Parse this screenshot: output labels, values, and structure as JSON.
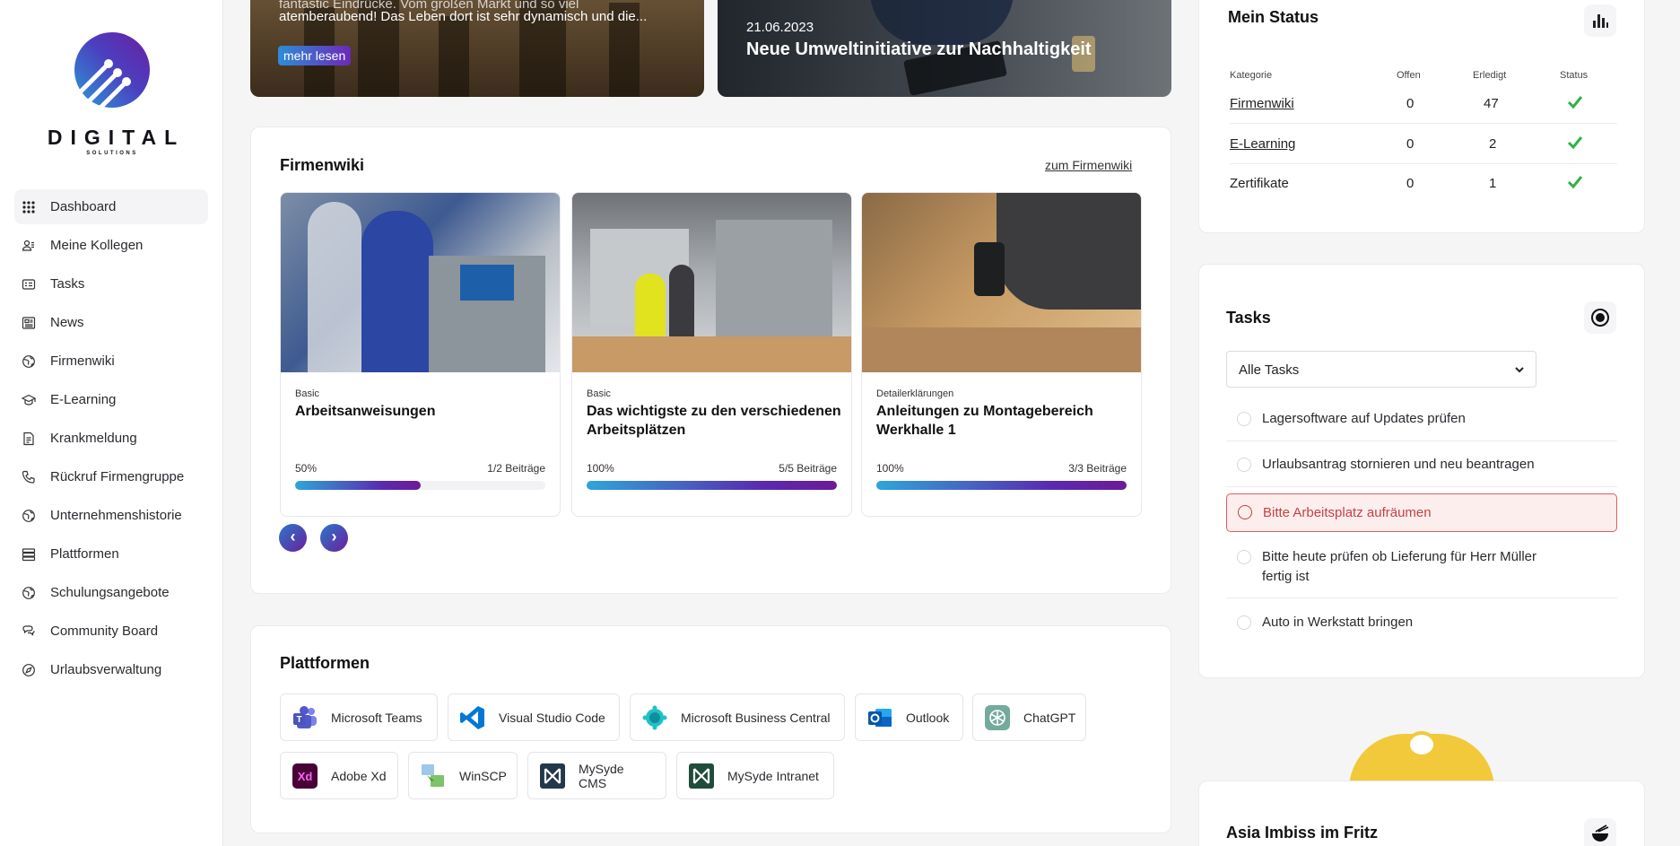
{
  "brand": {
    "name": "DIGITAL",
    "sub": "SOLUTIONS"
  },
  "nav": [
    {
      "label": "Dashboard",
      "icon": "grid-icon",
      "active": true
    },
    {
      "label": "Meine Kollegen",
      "icon": "people-icon"
    },
    {
      "label": "Tasks",
      "icon": "task-list-icon"
    },
    {
      "label": "News",
      "icon": "newspaper-icon"
    },
    {
      "label": "Firmenwiki",
      "icon": "globe-icon"
    },
    {
      "label": "E-Learning",
      "icon": "graduation-cap-icon"
    },
    {
      "label": "Krankmeldung",
      "icon": "document-icon"
    },
    {
      "label": "Rückruf Firmengruppe",
      "icon": "phone-icon"
    },
    {
      "label": "Unternehmenshistorie",
      "icon": "globe-icon"
    },
    {
      "label": "Plattformen",
      "icon": "server-icon"
    },
    {
      "label": "Schulungsangebote",
      "icon": "globe-icon"
    },
    {
      "label": "Community Board",
      "icon": "chat-icon"
    },
    {
      "label": "Urlaubsverwaltung",
      "icon": "compass-icon"
    }
  ],
  "news": [
    {
      "text_line1": "fantastic Eindrücke. Vom großen Markt und so viel",
      "text": "atemberaubend! Das Leben dort ist sehr dynamisch und die...",
      "button": "mehr lesen"
    },
    {
      "date": "21.06.2023",
      "title": "Neue Umweltinitiative zur Nachhaltigkeit"
    }
  ],
  "wiki": {
    "title": "Firmenwiki",
    "link": "zum Firmenwiki",
    "cards": [
      {
        "category": "Basic",
        "title": "Arbeitsanweisungen",
        "percent": "50%",
        "progress": 0.5,
        "count": "1/2 Beiträge"
      },
      {
        "category": "Basic",
        "title": "Das wichtigste zu den verschiedenen Arbeitsplätzen",
        "percent": "100%",
        "progress": 1,
        "count": "5/5 Beiträge"
      },
      {
        "category": "Detailerklärungen",
        "title": "Anleitungen zu Montagebereich Werkhalle 1",
        "percent": "100%",
        "progress": 1,
        "count": "3/3 Beiträge"
      }
    ],
    "prev": "‹",
    "next": "›"
  },
  "platforms": {
    "title": "Plattformen",
    "items": [
      {
        "label": "Microsoft Teams",
        "icon": "microsoft-teams-icon",
        "color": "#5059c9"
      },
      {
        "label": "Visual Studio Code",
        "icon": "vscode-icon",
        "color": "#0078d4"
      },
      {
        "label": "Microsoft Business Central",
        "icon": "business-central-icon",
        "color": "#14b8c4"
      },
      {
        "label": "Outlook",
        "icon": "outlook-icon",
        "color": "#0a64c8"
      },
      {
        "label": "ChatGPT",
        "icon": "chatgpt-icon",
        "color": "#74aa9c"
      },
      {
        "label": "Adobe Xd",
        "icon": "adobe-xd-icon",
        "color": "#470137"
      },
      {
        "label": "WinSCP",
        "icon": "winscp-icon",
        "color": "#4e9a32"
      },
      {
        "label": "MySyde CMS",
        "icon": "mysyde-cms-icon",
        "color": "#24384a"
      },
      {
        "label": "MySyde Intranet",
        "icon": "mysyde-intranet-icon",
        "color": "#1f4d3a"
      }
    ]
  },
  "status": {
    "title": "Mein Status",
    "headers": {
      "category": "Kategorie",
      "open": "Offen",
      "done": "Erledigt",
      "status": "Status"
    },
    "rows": [
      {
        "category": "Firmenwiki",
        "open": "0",
        "done": "47",
        "link": true
      },
      {
        "category": "E-Learning",
        "open": "0",
        "done": "2",
        "link": true
      },
      {
        "category": "Zertifikate",
        "open": "0",
        "done": "1",
        "link": false
      }
    ]
  },
  "tasks": {
    "title": "Tasks",
    "filter": "Alle Tasks",
    "items": [
      {
        "line1": "Lagersoftware auf Updates prüfen",
        "line2": ""
      },
      {
        "line1": "Urlaubsantrag stornieren und neu beantragen",
        "line2": ""
      },
      {
        "line1": "Bitte Arbeitsplatz aufräumen",
        "line2": "",
        "highlight": true
      },
      {
        "line1": "Bitte heute prüfen ob Lieferung für Herr Müller",
        "line2": "fertig ist"
      },
      {
        "line1": "Auto in Werkstatt bringen",
        "line2": ""
      }
    ]
  },
  "lunch": {
    "title": "Asia Imbiss im Fritz"
  }
}
